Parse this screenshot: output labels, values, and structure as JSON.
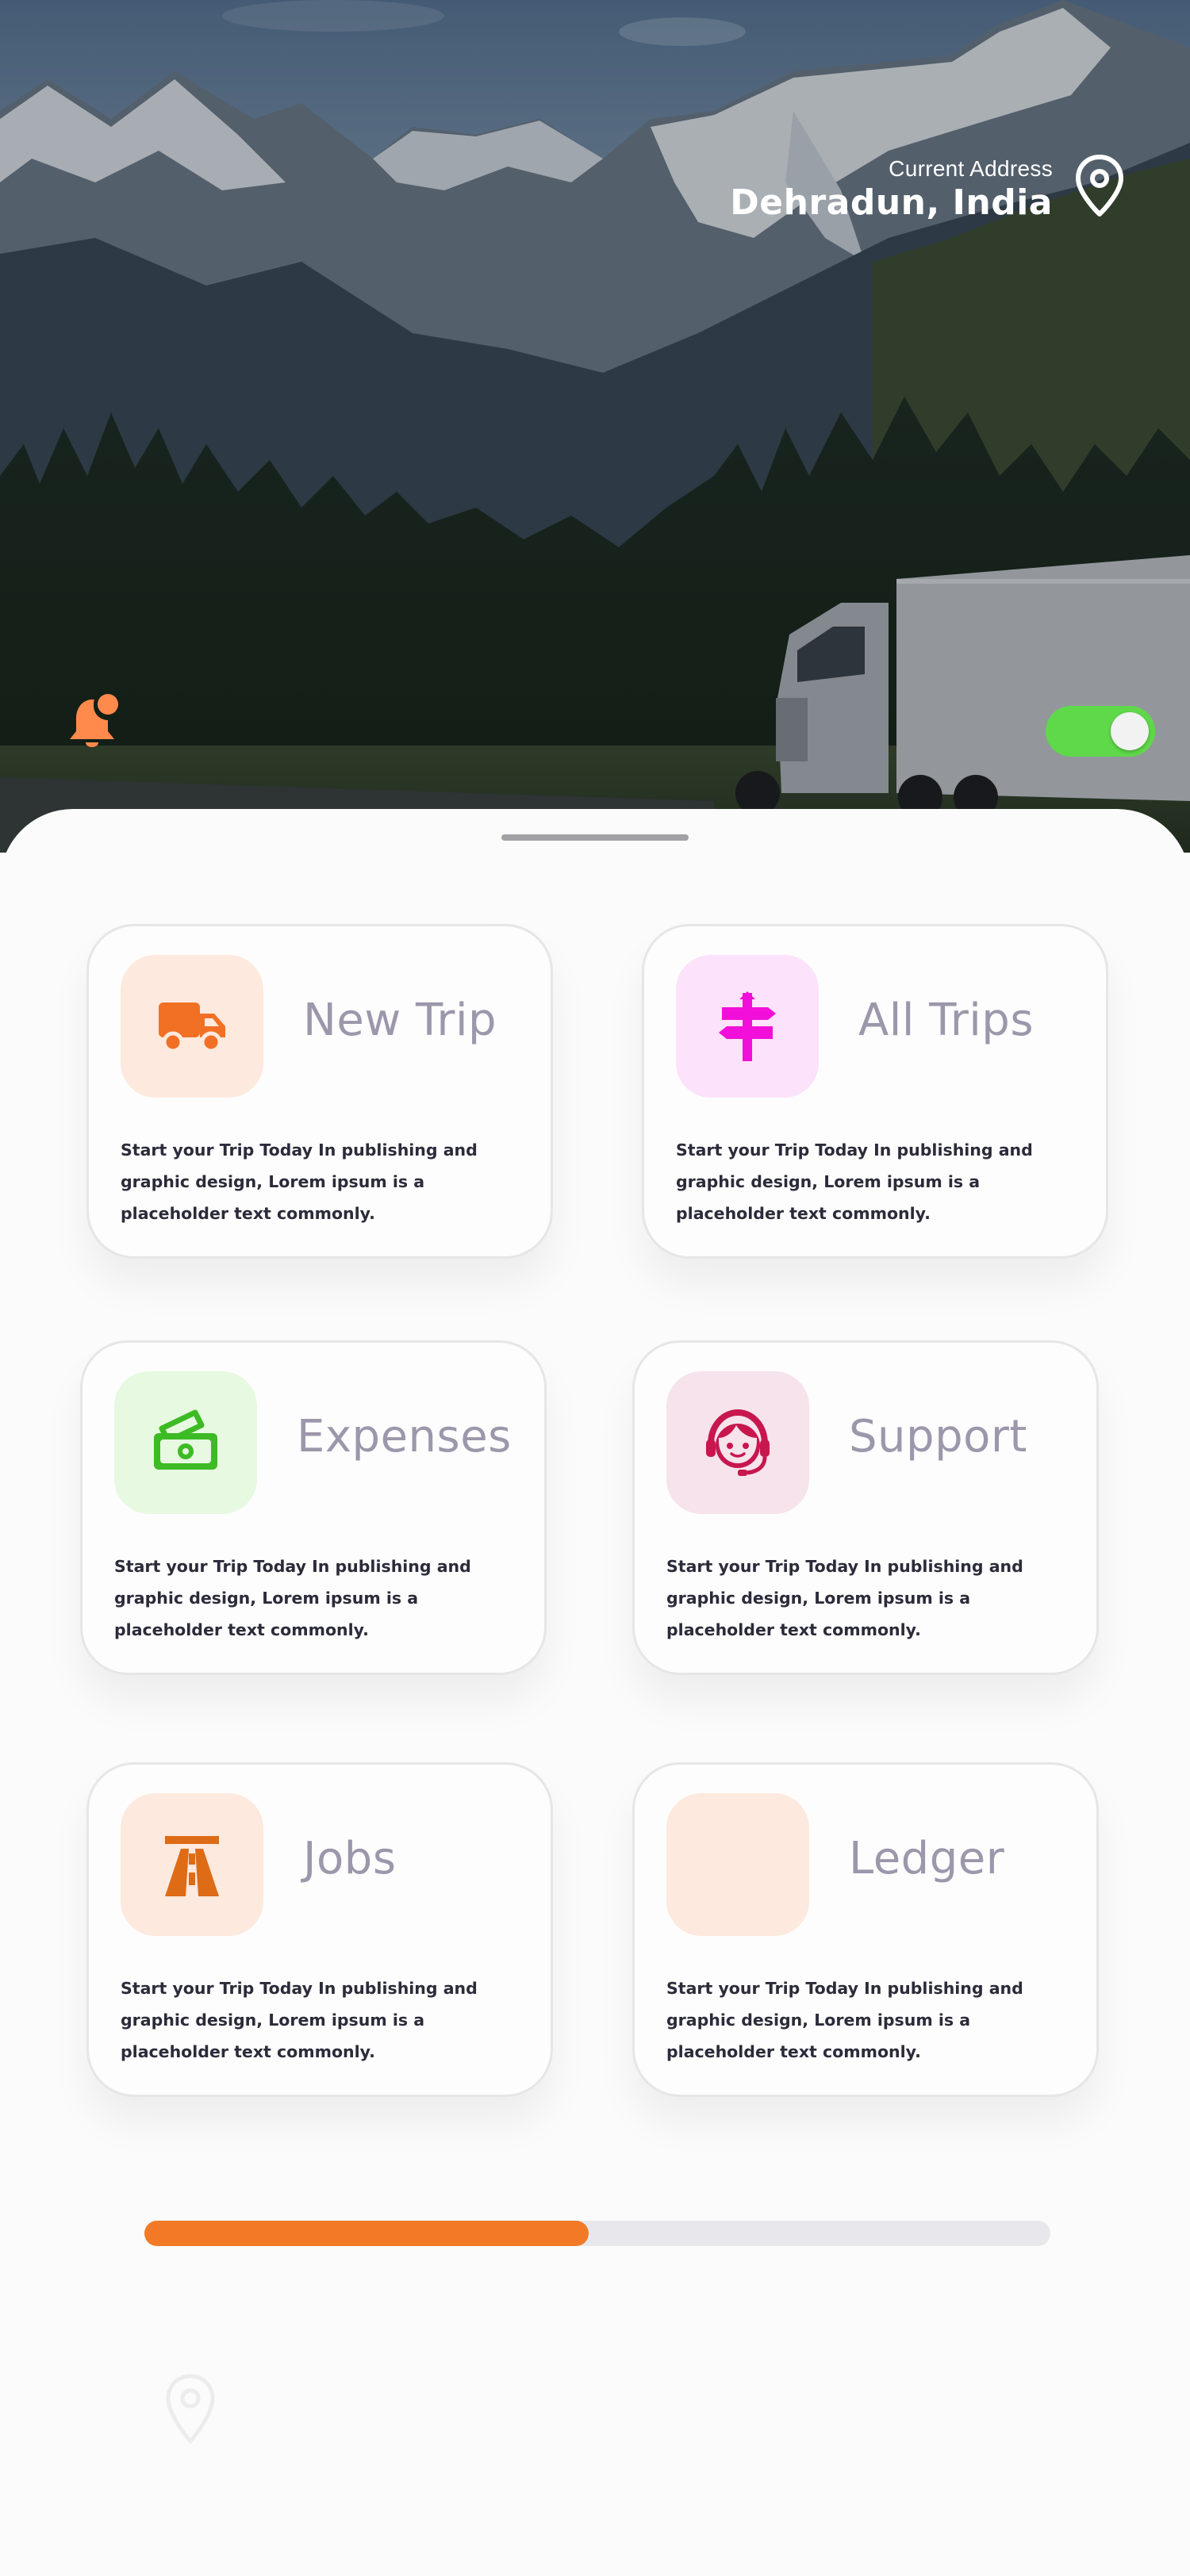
{
  "header": {
    "address_caption": "Current Address",
    "address_value": "Dehradun, India",
    "toggle_on": true
  },
  "cards": [
    {
      "title": "New Trip",
      "icon": "truck-icon",
      "description": "Start your Trip Today In publishing and graphic design, Lorem ipsum is a placeholder text commonly."
    },
    {
      "title": "All Trips",
      "icon": "signpost-icon",
      "description": "Start your Trip Today In publishing and graphic design, Lorem ipsum is a placeholder text commonly."
    },
    {
      "title": "Expenses",
      "icon": "money-icon",
      "description": "Start your Trip Today In publishing and graphic design, Lorem ipsum is a placeholder text commonly."
    },
    {
      "title": "Support",
      "icon": "support-agent-icon",
      "description": "Start your Trip Today In publishing and graphic design, Lorem ipsum is a placeholder text commonly."
    },
    {
      "title": "Jobs",
      "icon": "road-icon",
      "description": "Start your Trip Today In publishing and graphic design, Lorem ipsum is a placeholder text commonly."
    },
    {
      "title": "Ledger",
      "icon": "ledger-icon",
      "description": "Start your Trip Today In publishing and graphic design, Lorem ipsum is a placeholder text commonly."
    }
  ],
  "colors": {
    "accent": "#f27925",
    "toggle": "#5fd84a",
    "title_text": "#9c97ab",
    "body_text": "#2b2b3a"
  },
  "progress": {
    "fraction": 0.49
  }
}
